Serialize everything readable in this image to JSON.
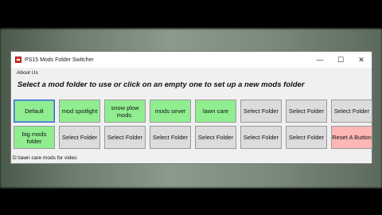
{
  "window": {
    "title": "PS15 Mods Folder Switcher",
    "controls": {
      "minimize": "—",
      "maximize": "☐",
      "close": "✕"
    }
  },
  "menu": {
    "about": "About Us"
  },
  "instruction": "Select a mod folder to use or click on an empty one to set up a new mods folder",
  "buttons": [
    {
      "label": "Default",
      "state": "used",
      "selected": true
    },
    {
      "label": "mod spotlight",
      "state": "used"
    },
    {
      "label": "snow plow mods.",
      "state": "used"
    },
    {
      "label": "mods sever",
      "state": "used"
    },
    {
      "label": "lawn care",
      "state": "used"
    },
    {
      "label": "Select Folder",
      "state": "empty"
    },
    {
      "label": "Select Folder",
      "state": "empty"
    },
    {
      "label": "Select Folder",
      "state": "empty"
    },
    {
      "label": "big mods folder",
      "state": "used"
    },
    {
      "label": "Select Folder",
      "state": "empty"
    },
    {
      "label": "Select Folder",
      "state": "empty"
    },
    {
      "label": "Select Folder",
      "state": "empty"
    },
    {
      "label": "Select Folder",
      "state": "empty"
    },
    {
      "label": "Select Folder",
      "state": "empty"
    },
    {
      "label": "Select Folder",
      "state": "empty"
    },
    {
      "label": "Reset A Button",
      "state": "reset"
    }
  ],
  "status": {
    "path": "D:\\lawn care mods for video"
  },
  "colors": {
    "used": "#90ee90",
    "empty": "#dcdcdc",
    "reset": "#ffb6b6",
    "accent": "#2f6cbf"
  }
}
